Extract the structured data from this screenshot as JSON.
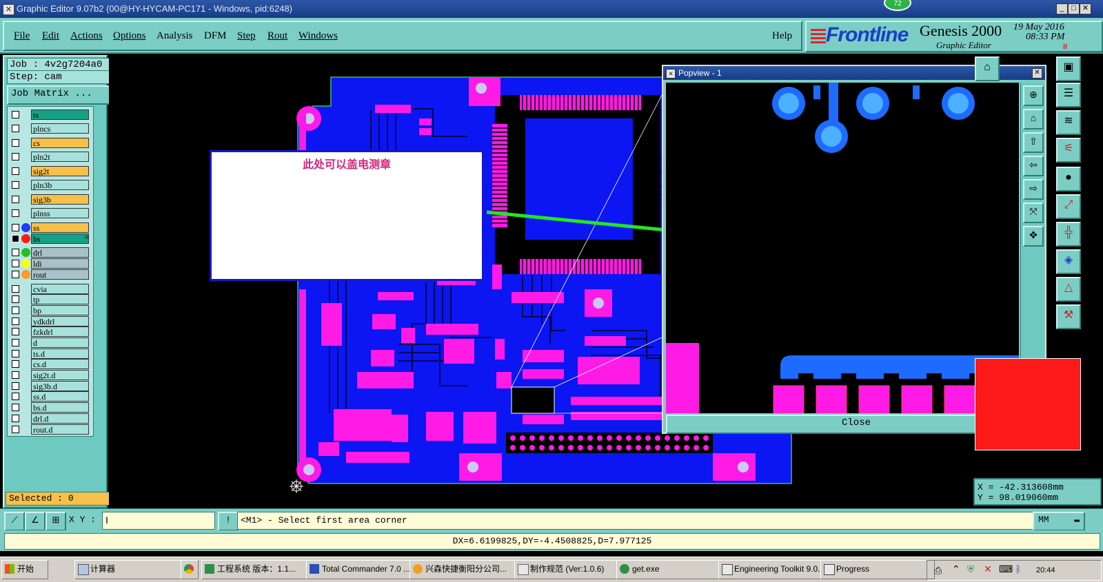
{
  "window": {
    "title": "Graphic Editor 9.07b2 (00@HY-HYCAM-PC171 - Windows, pid:6248)",
    "badge": "72"
  },
  "menu": {
    "items": [
      "File",
      "Edit",
      "Actions",
      "Options",
      "Analysis",
      "DFM",
      "Step",
      "Rout",
      "Windows"
    ],
    "help": "Help"
  },
  "brand": {
    "logo": "Frontline",
    "product": "Genesis 2000",
    "subtitle": "Graphic Editor",
    "date": "19 May 2016",
    "time": "08:33 PM",
    "pause": "II"
  },
  "job": {
    "job": "Job : 4v2g7204a0",
    "step": "Step: cam",
    "matrix_btn": "Job Matrix ..."
  },
  "layers": [
    {
      "name": "ts",
      "bg": "#16a085"
    },
    {
      "name": "plncs",
      "bg": "#a6e1dc"
    },
    {
      "name": "cs",
      "bg": "#f6c04a"
    },
    {
      "name": "pln2t",
      "bg": "#a6e1dc"
    },
    {
      "name": "sig2t",
      "bg": "#f6c04a"
    },
    {
      "name": "pln3b",
      "bg": "#a6e1dc"
    },
    {
      "name": "sig3b",
      "bg": "#f6c04a"
    },
    {
      "name": "plnss",
      "bg": "#a6e1dc"
    },
    {
      "name": "ss",
      "bg": "#f6c04a",
      "dot": "#1f3cff"
    },
    {
      "name": "bs",
      "bg": "#16a085",
      "dot": "#ff1a1a",
      "active": true,
      "mark": "="
    },
    {
      "name": "drl",
      "bg": "#a9c2c9",
      "dot": "#22c022"
    },
    {
      "name": "ldi",
      "bg": "#a9c2c9",
      "dot": "#ffff1a"
    },
    {
      "name": "rout",
      "bg": "#a9c2c9",
      "dot": "#ff9a22"
    },
    {
      "name": "cvia",
      "bg": "#a6e1dc"
    },
    {
      "name": "tp",
      "bg": "#a6e1dc"
    },
    {
      "name": "bp",
      "bg": "#a6e1dc"
    },
    {
      "name": "ydkdrl",
      "bg": "#a6e1dc"
    },
    {
      "name": "fzkdrl",
      "bg": "#a6e1dc"
    },
    {
      "name": "d",
      "bg": "#a6e1dc"
    },
    {
      "name": "ts.d",
      "bg": "#a6e1dc"
    },
    {
      "name": "cs.d",
      "bg": "#a6e1dc"
    },
    {
      "name": "sig2t.d",
      "bg": "#a6e1dc"
    },
    {
      "name": "sig3b.d",
      "bg": "#a6e1dc"
    },
    {
      "name": "ss.d",
      "bg": "#a6e1dc"
    },
    {
      "name": "bs.d",
      "bg": "#a6e1dc"
    },
    {
      "name": "drl.d",
      "bg": "#a6e1dc"
    },
    {
      "name": "rout.d",
      "bg": "#a6e1dc"
    }
  ],
  "selected": "Selected : 0",
  "note": "此处可以盖电测章",
  "popview": {
    "title": "Popview - 1",
    "close": "Close"
  },
  "coords": {
    "x": "X = -42.313608mm",
    "y": "Y = 98.019060mm"
  },
  "cmd": {
    "xy_label": "X Y :",
    "prompt": "<M1> - Select first area corner",
    "units": "MM"
  },
  "status": "DX=6.6199825,DY=-4.4508825,D=7.977125",
  "taskbar": {
    "start": "开始",
    "tasks": [
      "计算器",
      "工程系统  版本：1.1...",
      "Total Commander 7.0 ...",
      "兴森快捷衡阳分公司...",
      "制作规范 (Ver:1.0.6)",
      "get.exe",
      "Engineering Toolkit 9.0...",
      "Progress"
    ],
    "clock": "20:44"
  },
  "colors": {
    "board": "#0b16f2",
    "pad": "#ff1ae6",
    "copper": "#1d6cff",
    "teal": "#7ccdc4"
  }
}
